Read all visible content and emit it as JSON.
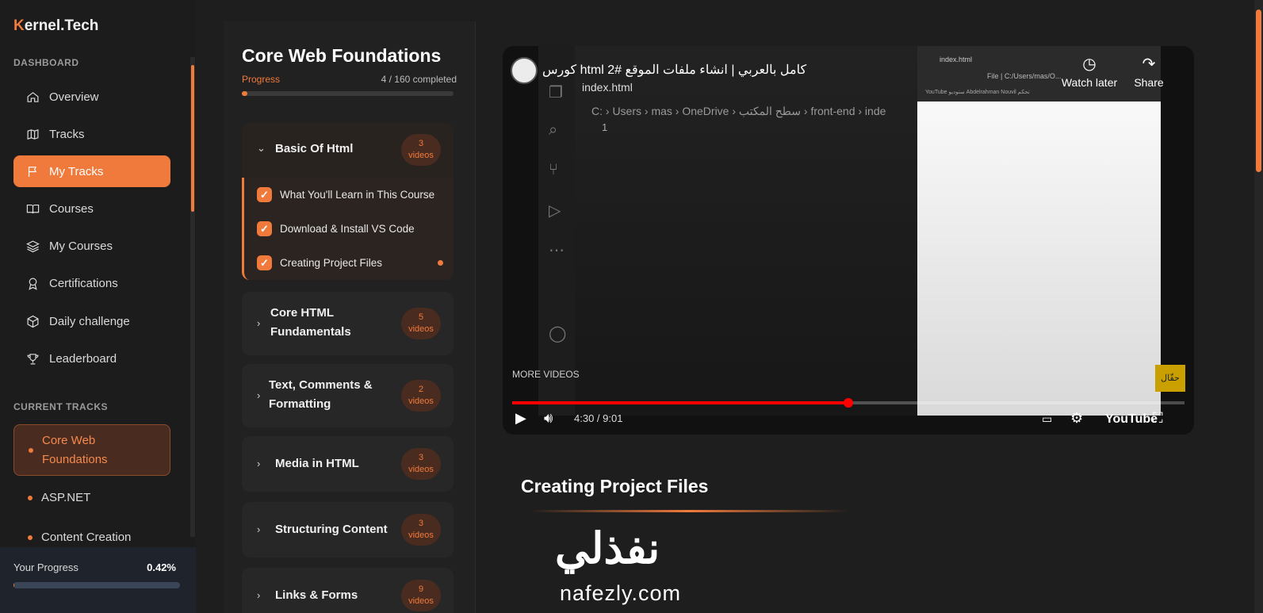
{
  "brand": {
    "first_letter": "K",
    "rest": "ernel.Tech"
  },
  "sidebar": {
    "dashboard_title": "DASHBOARD",
    "items": [
      {
        "label": "Overview",
        "icon": "home-icon"
      },
      {
        "label": "Tracks",
        "icon": "map-icon"
      },
      {
        "label": "My Tracks",
        "icon": "flag-icon",
        "active": true
      },
      {
        "label": "Courses",
        "icon": "book-icon"
      },
      {
        "label": "My Courses",
        "icon": "layers-icon"
      },
      {
        "label": "Certifications",
        "icon": "award-icon"
      },
      {
        "label": "Daily challenge",
        "icon": "cube-icon"
      },
      {
        "label": "Leaderboard",
        "icon": "trophy-icon"
      }
    ],
    "current_tracks_title": "CURRENT TRACKS",
    "tracks": [
      "Core Web Foundations",
      "ASP.NET",
      "Content Creation"
    ],
    "your_progress_label": "Your Progress",
    "your_progress_value": "0.42%",
    "your_progress_fraction": 0.0042
  },
  "course": {
    "title": "Core Web Foundations",
    "progress_label": "Progress",
    "progress_count": "4 / 160 completed",
    "progress_fraction": 0.025,
    "modules": [
      {
        "title": "Basic Of Html",
        "count": "3",
        "unit": "videos",
        "expanded": true,
        "lessons": [
          "What You'll Learn in This Course",
          "Download & Install VS Code",
          "Creating Project Files"
        ]
      },
      {
        "title": "Core HTML Fundamentals",
        "count": "5",
        "unit": "videos"
      },
      {
        "title": "Text, Comments & Formatting",
        "count": "2",
        "unit": "videos"
      },
      {
        "title": "Media in HTML",
        "count": "3",
        "unit": "videos"
      },
      {
        "title": "Structuring Content",
        "count": "3",
        "unit": "videos"
      },
      {
        "title": "Links & Forms",
        "count": "9",
        "unit": "videos"
      }
    ]
  },
  "video": {
    "title": "كورس html كامل بالعربي | انشاء ملفات الموقع #2",
    "watch_later": "Watch later",
    "share": "Share",
    "more_videos": "MORE VIDEOS",
    "time": "4:30 / 9:01",
    "played_fraction": 0.5,
    "youtube": "YouTube",
    "channel_badge": "حقّال",
    "editor": {
      "tab": "index.html",
      "breadcrumb": "C: › Users › mas › OneDrive › سطح المكتب › front-end › inde",
      "line_no": "1"
    },
    "browser": {
      "tab": "index.html",
      "url": "File | C:/Users/mas/O...",
      "bookmarks": "YouTube  ستوديو  Abdelrahman  Nouvil  تحكم"
    }
  },
  "lesson": {
    "title": "Creating Project Files"
  },
  "watermark": {
    "arabic": "نفذلي",
    "latin": "nafezly.com"
  },
  "colors": {
    "accent": "#f07a3c",
    "background": "#1e1e1e",
    "panel": "#212121"
  }
}
